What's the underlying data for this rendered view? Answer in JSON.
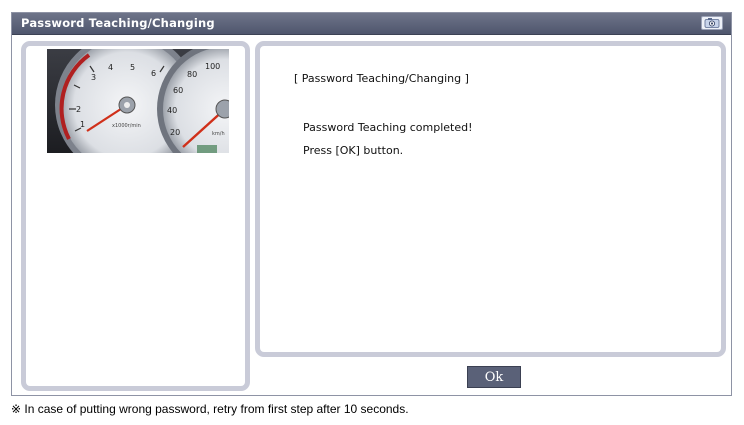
{
  "window": {
    "title": "Password Teaching/Changing",
    "title_bar_color": "#5b6278",
    "panel_border_color": "#c9cbd8"
  },
  "toolbar": {
    "camera_icon": "camera-icon"
  },
  "gauge": {
    "tach_labels": [
      "1",
      "2",
      "3",
      "4",
      "5",
      "6"
    ],
    "tach_unit": "x1000r/min",
    "speed_labels": [
      "20",
      "40",
      "60",
      "80",
      "100"
    ],
    "speed_unit": "km/h"
  },
  "message": {
    "heading": "[ Password Teaching/Changing ]",
    "line1": "Password Teaching completed!",
    "line2": "Press [OK] button."
  },
  "buttons": {
    "ok_label": "Ok"
  },
  "footnote": "※ In case of putting wrong password, retry from first step after 10 seconds."
}
